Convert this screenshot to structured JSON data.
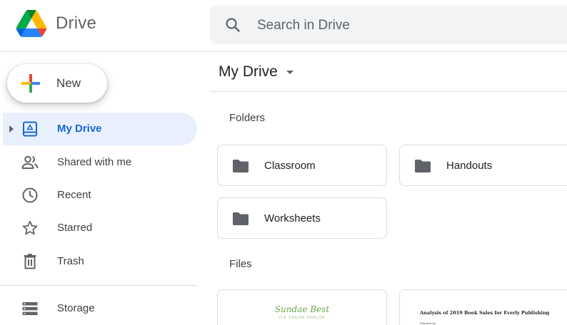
{
  "app": {
    "name": "Drive"
  },
  "search": {
    "placeholder": "Search in Drive"
  },
  "new_button": {
    "label": "New"
  },
  "sidebar": {
    "items": [
      {
        "label": "My Drive",
        "icon": "my-drive-icon",
        "active": true
      },
      {
        "label": "Shared with me",
        "icon": "shared-icon"
      },
      {
        "label": "Recent",
        "icon": "clock-icon"
      },
      {
        "label": "Starred",
        "icon": "star-icon"
      },
      {
        "label": "Trash",
        "icon": "trash-icon"
      }
    ],
    "storage": {
      "label": "Storage",
      "icon": "storage-icon"
    }
  },
  "main": {
    "title": "My Drive",
    "folders_label": "Folders",
    "folders": [
      {
        "name": "Classroom"
      },
      {
        "name": "Handouts"
      },
      {
        "name": "Worksheets"
      }
    ],
    "files_label": "Files",
    "files": [
      {
        "preview_title": "Sundae Best",
        "preview_subtitle": "ICE CREAM PARLOR"
      },
      {
        "preview_title": "Analysis of 2019 Book Sales for Everly Publishing",
        "preview_subtitle": "Prepared by:"
      }
    ]
  },
  "colors": {
    "accent": "#1967d2",
    "active_bg": "#e8f0fe",
    "search_bg": "#f1f3f4",
    "folder_icon": "#5f6368"
  }
}
